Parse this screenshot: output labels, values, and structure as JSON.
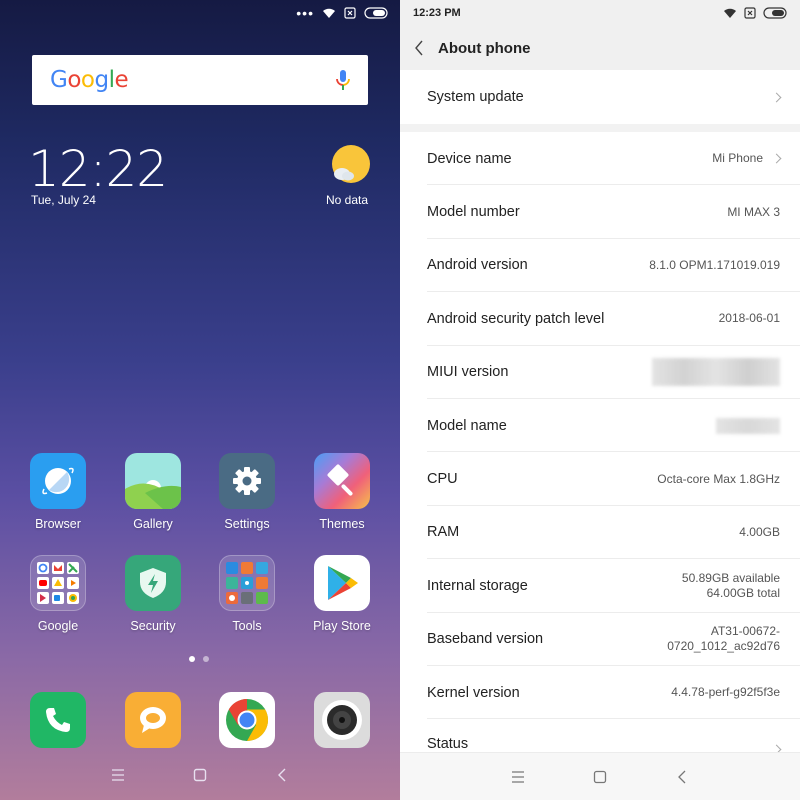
{
  "home": {
    "search": {
      "logo_text": "Google",
      "logo_letters": [
        {
          "ch": "G",
          "color": "#4285F4"
        },
        {
          "ch": "o",
          "color": "#EA4335"
        },
        {
          "ch": "o",
          "color": "#FBBC05"
        },
        {
          "ch": "g",
          "color": "#4285F4"
        },
        {
          "ch": "l",
          "color": "#34A853"
        },
        {
          "ch": "e",
          "color": "#EA4335"
        }
      ],
      "mic_icon": "mic-icon"
    },
    "clock": {
      "time": "12:22",
      "date": "Tue, July 24"
    },
    "weather": {
      "icon": "sun-cloud-icon",
      "label": "No data"
    },
    "apps_row1": [
      {
        "label": "Browser",
        "icon": "browser-icon"
      },
      {
        "label": "Gallery",
        "icon": "gallery-icon"
      },
      {
        "label": "Settings",
        "icon": "settings-gear-icon"
      },
      {
        "label": "Themes",
        "icon": "themes-brush-icon"
      }
    ],
    "apps_row2": [
      {
        "label": "Google",
        "icon": "google-folder-icon"
      },
      {
        "label": "Security",
        "icon": "security-shield-icon"
      },
      {
        "label": "Tools",
        "icon": "tools-folder-icon"
      },
      {
        "label": "Play Store",
        "icon": "play-store-icon"
      }
    ],
    "dock": [
      {
        "label": "Phone",
        "icon": "phone-icon"
      },
      {
        "label": "Messaging",
        "icon": "messaging-icon"
      },
      {
        "label": "Chrome",
        "icon": "chrome-icon"
      },
      {
        "label": "Camera",
        "icon": "camera-icon"
      }
    ],
    "page_indicator": {
      "count": 2,
      "active": 1
    }
  },
  "settings": {
    "status_time": "12:23 PM",
    "title": "About phone",
    "top_item": {
      "label": "System update"
    },
    "items": [
      {
        "label": "Device name",
        "value": "Mi Phone",
        "chevron": true
      },
      {
        "label": "Model number",
        "value": "MI MAX 3"
      },
      {
        "label": "Android version",
        "value": "8.1.0 OPM1.171019.019"
      },
      {
        "label": "Android security patch level",
        "value": "2018-06-01"
      },
      {
        "label": "MIUI version",
        "value": "[blurred]"
      },
      {
        "label": "Model name",
        "value": "[blurred]"
      },
      {
        "label": "CPU",
        "value": "Octa-core Max 1.8GHz"
      },
      {
        "label": "RAM",
        "value": "4.00GB"
      },
      {
        "label": "Internal storage",
        "value_line1": "50.89GB available",
        "value_line2": "64.00GB total"
      },
      {
        "label": "Baseband version",
        "value_line1": "AT31-00672-",
        "value_line2": "0720_1012_ac92d76"
      },
      {
        "label": "Kernel version",
        "value": "4.4.78-perf-g92f5f3e"
      },
      {
        "label": "Status",
        "chevron": true
      }
    ]
  },
  "colors": {
    "home_bg_top": "#151a43",
    "home_bg_bottom": "#b27d9c",
    "settings_bg": "#f7f7f7"
  }
}
